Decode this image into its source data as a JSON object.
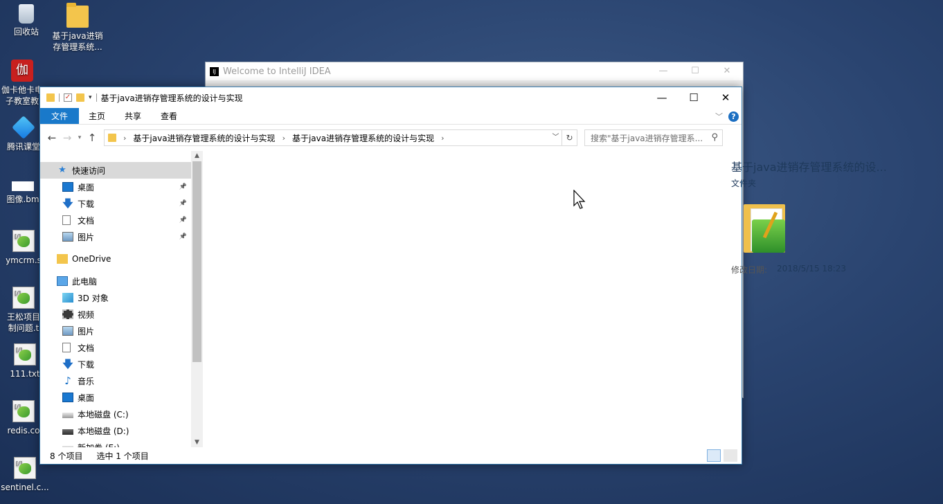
{
  "desktop": {
    "icons": [
      {
        "label1": "回收站",
        "label2": ""
      },
      {
        "label1": "基于java进销",
        "label2": "存管理系统..."
      },
      {
        "label1": "伽卡他卡电",
        "label2": "子教室教"
      },
      {
        "label1": "腾讯课堂",
        "label2": ""
      },
      {
        "label1": "图像.bm",
        "label2": ""
      },
      {
        "label1": "ymcrm.s",
        "label2": ""
      },
      {
        "label1": "王松项目",
        "label2": "制问题.t"
      },
      {
        "label1": "111.txt",
        "label2": ""
      },
      {
        "label1": "redis.co",
        "label2": ""
      },
      {
        "label1": "sentinel.c...",
        "label2": ""
      }
    ]
  },
  "idea_window": {
    "title": "Welcome to IntelliJ IDEA",
    "min": "—",
    "max": "☐",
    "close": "✕"
  },
  "explorer": {
    "title": "基于java进销存管理系统的设计与实现",
    "window_controls": {
      "min": "—",
      "max": "☐",
      "close": "✕"
    },
    "ribbon_tabs": [
      "文件",
      "主页",
      "共享",
      "查看"
    ],
    "help": "?",
    "breadcrumb": [
      "基于java进销存管理系统的设计与实现",
      "基于java进销存管理系统的设计与实现"
    ],
    "search_placeholder": "搜索\"基于java进销存管理系...",
    "nav": [
      {
        "label": "快速访问",
        "icon": "star-icon",
        "pinned": false,
        "indent": 0
      },
      {
        "label": "桌面",
        "icon": "desktop-icon",
        "pinned": true,
        "indent": 1
      },
      {
        "label": "下载",
        "icon": "download-icon",
        "pinned": true,
        "indent": 1
      },
      {
        "label": "文档",
        "icon": "document-icon",
        "pinned": true,
        "indent": 1
      },
      {
        "label": "图片",
        "icon": "pictures-icon",
        "pinned": true,
        "indent": 1
      },
      {
        "label": "OneDrive",
        "icon": "folder-icon",
        "pinned": false,
        "indent": 0
      },
      {
        "label": "此电脑",
        "icon": "computer-icon",
        "pinned": false,
        "indent": 0
      },
      {
        "label": "3D 对象",
        "icon": "3d-objects-icon",
        "pinned": false,
        "indent": 1
      },
      {
        "label": "视频",
        "icon": "video-icon",
        "pinned": false,
        "indent": 1
      },
      {
        "label": "图片",
        "icon": "pictures-icon",
        "pinned": false,
        "indent": 1
      },
      {
        "label": "文档",
        "icon": "document-icon",
        "pinned": false,
        "indent": 1
      },
      {
        "label": "下载",
        "icon": "download-icon",
        "pinned": false,
        "indent": 1
      },
      {
        "label": "音乐",
        "icon": "music-icon",
        "pinned": false,
        "indent": 1
      },
      {
        "label": "桌面",
        "icon": "desktop-icon",
        "pinned": false,
        "indent": 1
      },
      {
        "label": "本地磁盘 (C:)",
        "icon": "drive-icon",
        "pinned": false,
        "indent": 1
      },
      {
        "label": "本地磁盘 (D:)",
        "icon": "drive-icon",
        "pinned": false,
        "indent": 1
      },
      {
        "label": "新加卷 (E:)",
        "icon": "drive-icon",
        "pinned": false,
        "indent": 1
      }
    ],
    "details": {
      "name": "基于java进销存管理系统的设...",
      "type": "文件夹",
      "modified_label": "修改日期:",
      "modified_value": "2018/5/15 18:23"
    },
    "status": {
      "item_count": "8 个项目",
      "selected": "选中 1 个项目"
    }
  }
}
